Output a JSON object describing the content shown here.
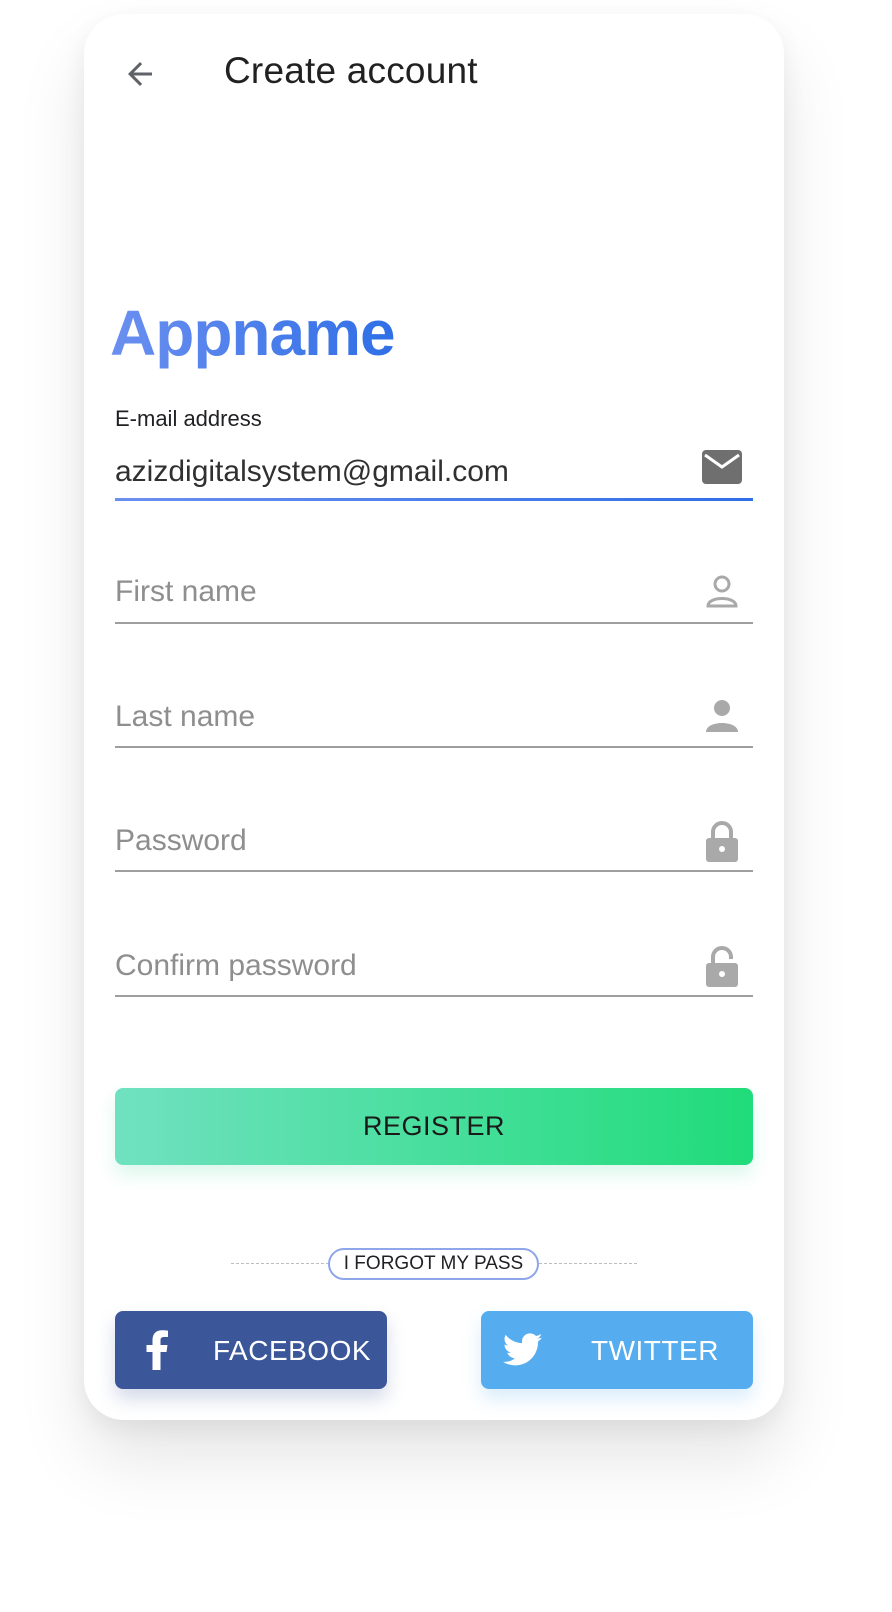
{
  "header": {
    "back_icon": "arrow-left-icon",
    "title": "Create account"
  },
  "brand": {
    "name": "Appname",
    "gradient": [
      "#6b8ff0",
      "#2f6fe6"
    ]
  },
  "form": {
    "email": {
      "label": "E-mail address",
      "value": "azizdigitalsystem@gmail.com",
      "icon": "mail-icon"
    },
    "first_name": {
      "placeholder": "First name",
      "icon": "person-outline-icon"
    },
    "last_name": {
      "placeholder": "Last name",
      "icon": "person-filled-icon"
    },
    "password": {
      "placeholder": "Password",
      "icon": "lock-icon"
    },
    "confirm_password": {
      "placeholder": "Confirm password",
      "icon": "lock-open-icon"
    }
  },
  "actions": {
    "register_label": "REGISTER",
    "register_gradient": [
      "#70e1c0",
      "#20dc7a"
    ],
    "forgot_label": "I FORGOT MY PASS",
    "facebook_label": "FACEBOOK",
    "facebook_color": "#3b5799",
    "twitter_label": "TWITTER",
    "twitter_color": "#55acee"
  }
}
